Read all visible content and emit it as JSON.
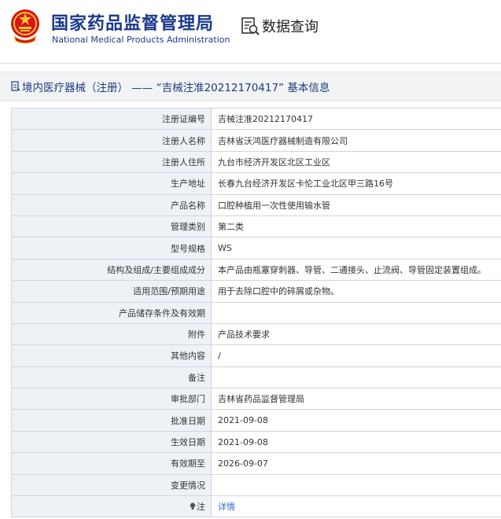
{
  "header": {
    "org_name_cn": "国家药品监督管理局",
    "org_name_en": "National Medical Products Administration",
    "data_query_label": "数据查询"
  },
  "page_title": "境内医疗器械（注册） ——  “吉械注准20212170417” 基本信息",
  "fields": [
    {
      "label": "注册证编号",
      "value": "吉械注准20212170417"
    },
    {
      "label": "注册人名称",
      "value": "吉林省沃鸿医疗器械制造有限公司"
    },
    {
      "label": "注册人住所",
      "value": "九台市经济开发区北区工业区"
    },
    {
      "label": "生产地址",
      "value": "长春九台经济开发区卡伦工业北区甲三路16号"
    },
    {
      "label": "产品名称",
      "value": "口腔种植用一次性使用输水管"
    },
    {
      "label": "管理类别",
      "value": "第二类"
    },
    {
      "label": "型号规格",
      "value": "WS"
    },
    {
      "label": "结构及组成/主要组成成分",
      "value": "本产品由瓶塞穿刺器、导管、二通接头、止流阀、导管固定装置组成。"
    },
    {
      "label": "适用范围/预期用途",
      "value": "用于去除口腔中的碎屑或杂物。"
    },
    {
      "label": "产品储存条件及有效期",
      "value": ""
    },
    {
      "label": "附件",
      "value": "产品技术要求"
    },
    {
      "label": "其他内容",
      "value": "/"
    },
    {
      "label": "备注",
      "value": ""
    },
    {
      "label": "审批部门",
      "value": "吉林省药品监督管理局"
    },
    {
      "label": "批准日期",
      "value": "2021-09-08"
    },
    {
      "label": "生效日期",
      "value": "2021-09-08"
    },
    {
      "label": "有效期至",
      "value": "2026-09-07"
    },
    {
      "label": "变更情况",
      "value": ""
    }
  ],
  "note_row": {
    "label": "注",
    "link": "详情"
  },
  "colors": {
    "brand_blue": "#1a3a8a",
    "label_bg": "#eef2f7",
    "link": "#2e6bc6",
    "emblem_red": "#d7141a"
  },
  "icons": {
    "emblem": "national-emblem-icon",
    "query": "data-query-icon",
    "title": "document-icon",
    "note": "lightbulb-icon"
  }
}
